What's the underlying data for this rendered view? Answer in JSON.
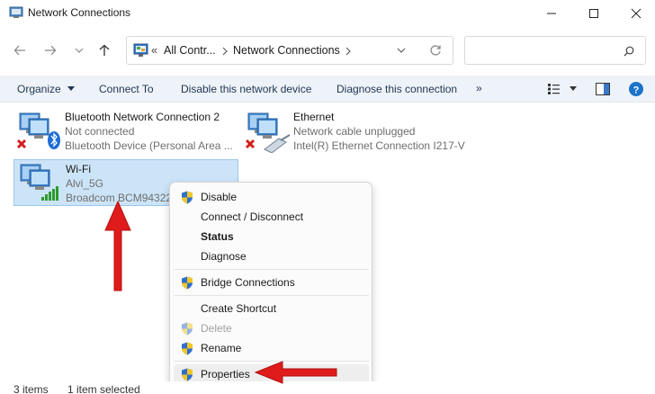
{
  "window": {
    "title": "Network Connections",
    "controls": [
      "minimize",
      "maximize",
      "close"
    ]
  },
  "navigation": {
    "back_icon": "arrow-left-icon",
    "forward_icon": "arrow-right-icon",
    "recent_icon": "chevron-down-icon",
    "up_icon": "arrow-up-icon",
    "breadcrumb": {
      "overflow": "«",
      "items": [
        "All Contr...",
        "Network Connections"
      ]
    },
    "refresh_icon": "refresh-icon",
    "search_placeholder": "",
    "search_icon": "search-icon"
  },
  "toolbar": {
    "organize": "Organize",
    "connect_to": "Connect To",
    "disable": "Disable this network device",
    "diagnose": "Diagnose this connection",
    "more": "»"
  },
  "connections": [
    {
      "name": "Bluetooth Network Connection 2",
      "status": "Not connected",
      "device": "Bluetooth Device (Personal Area ...",
      "icon": "bluetooth-network-icon",
      "status_icon": "red-x-icon"
    },
    {
      "name": "Ethernet",
      "status": "Network cable unplugged",
      "device": "Intel(R) Ethernet Connection I217-V",
      "icon": "ethernet-network-icon",
      "status_icon": "red-x-icon"
    },
    {
      "name": "Wi-Fi",
      "status": "Alvi_5G",
      "device": "Broadcom BCM94322",
      "icon": "wifi-network-icon",
      "status_icon": "signal-bars-icon",
      "selected": true
    }
  ],
  "context_menu": {
    "items": [
      {
        "label": "Disable",
        "shield": true
      },
      {
        "label": "Connect / Disconnect",
        "shield": false
      },
      {
        "label": "Status",
        "shield": false,
        "bold": true
      },
      {
        "label": "Diagnose",
        "shield": false
      },
      {
        "label": "Bridge Connections",
        "shield": true
      },
      {
        "label": "Create Shortcut",
        "shield": false
      },
      {
        "label": "Delete",
        "shield": true,
        "disabled": true
      },
      {
        "label": "Rename",
        "shield": true
      },
      {
        "label": "Properties",
        "shield": true,
        "highlighted": true
      }
    ]
  },
  "status_bar": {
    "count": "3 items",
    "selection": "1 item selected"
  },
  "colors": {
    "annotation_arrow": "#e01b1b",
    "selection": "#cce4f7",
    "toolbar_bg": "#eef3f9",
    "help_icon": "#1a73c9"
  }
}
